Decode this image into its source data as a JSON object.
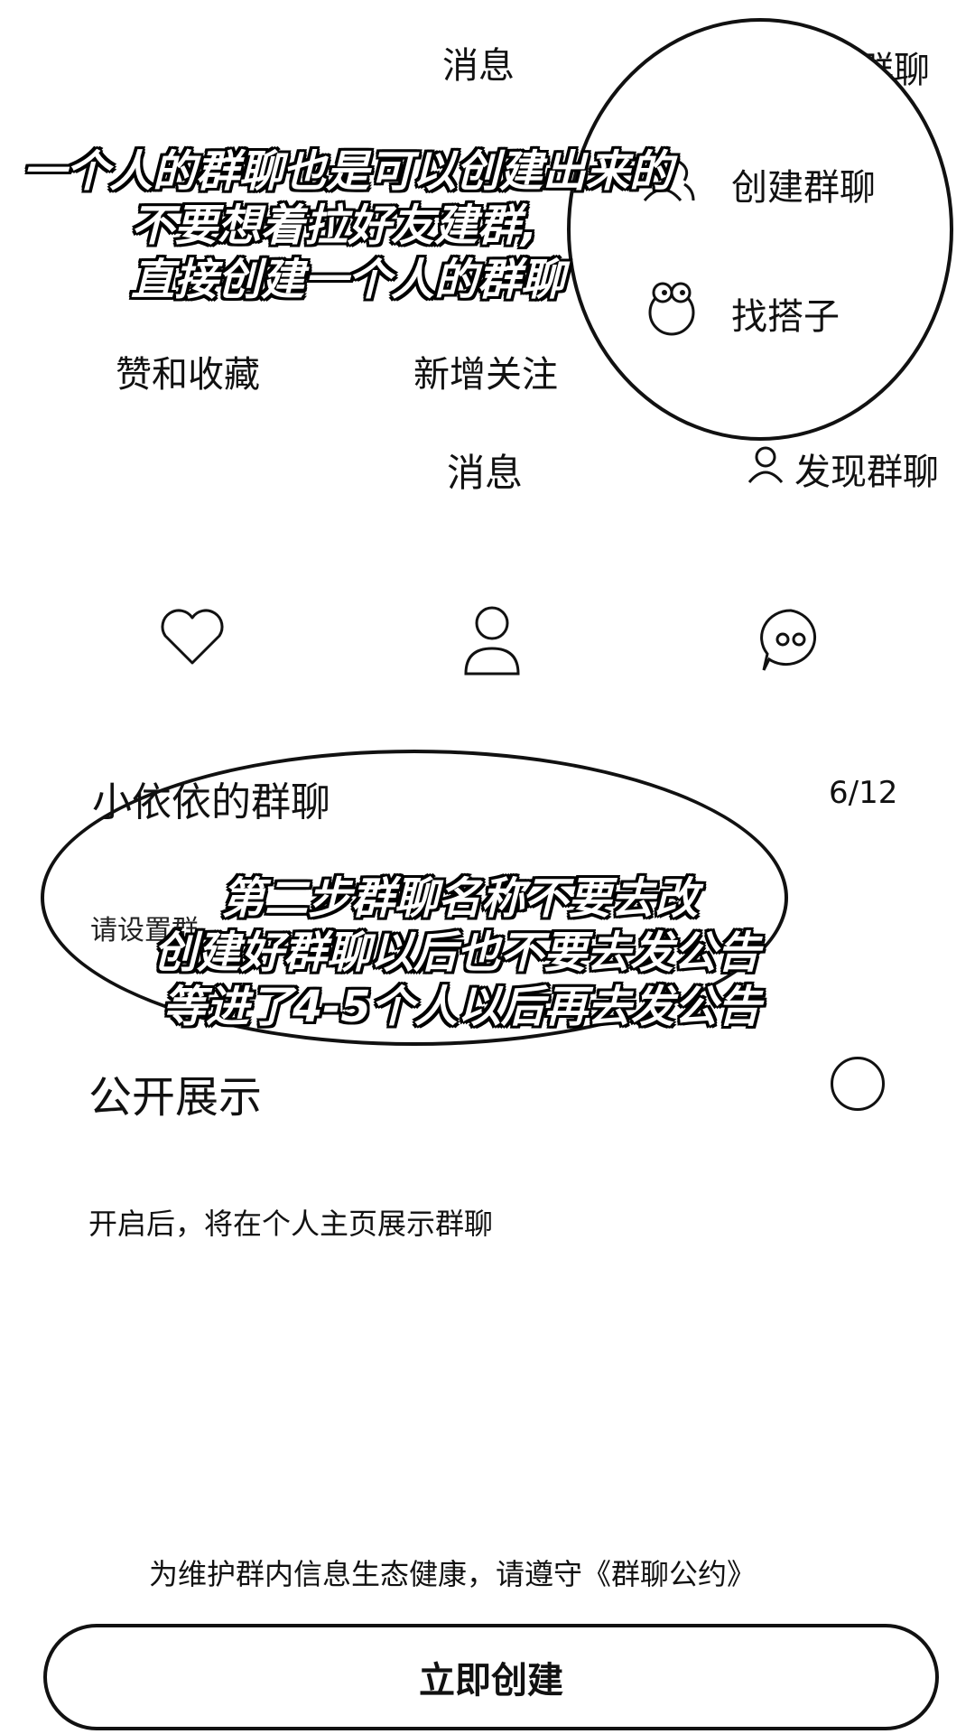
{
  "top_header": {
    "title": "消息",
    "discover_group": "发现群聊"
  },
  "dropdown_menu": {
    "create_group": "创建群聊",
    "find_partner": "找搭子"
  },
  "overlay_captions": {
    "top": [
      "一个人的群聊也是可以创建出来的",
      "不要想着拉好友建群,",
      "直接创建一个人的群聊"
    ],
    "middle": [
      "第二步群聊名称不要去改",
      "创建好群聊以后也不要去发公告",
      "等进了4-5个人以后再去发公告"
    ]
  },
  "tabs_row": {
    "likes": "赞和收藏",
    "followers": "新增关注"
  },
  "second_header": {
    "title": "消息",
    "discover_group": "发现群聊"
  },
  "icons_row": [
    {
      "icon": "heart-icon"
    },
    {
      "icon": "person-icon"
    },
    {
      "icon": "chat-bubble-icon"
    }
  ],
  "group_form": {
    "group_name": "小依依的群聊",
    "name_counter": "6/12",
    "intro_placeholder": "请设置群",
    "public_display_label": "公开展示",
    "public_display_desc": "开启后，将在个人主页展示群聊"
  },
  "footer": {
    "notice": "为维护群内信息生态健康，请遵守《群聊公约》",
    "create_button": "立即创建"
  }
}
